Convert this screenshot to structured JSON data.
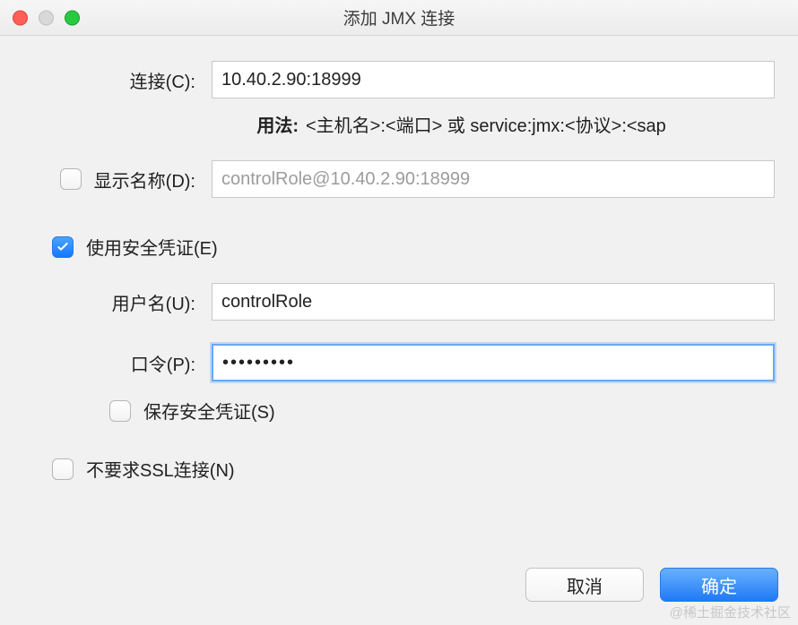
{
  "window": {
    "title": "添加 JMX 连接"
  },
  "form": {
    "connection_label": "连接(C):",
    "connection_value": "10.40.2.90:18999",
    "usage_label": "用法:",
    "usage_text": "<主机名>:<端口> 或 service:jmx:<协议>:<sap",
    "display_name_label": "显示名称(D):",
    "display_name_value": "controlRole@10.40.2.90:18999",
    "display_name_checked": false,
    "use_credentials_label": "使用安全凭证(E)",
    "use_credentials_checked": true,
    "username_label": "用户名(U):",
    "username_value": "controlRole",
    "password_label": "口令(P):",
    "password_value": "•••••••••",
    "save_credentials_label": "保存安全凭证(S)",
    "save_credentials_checked": false,
    "no_ssl_label": "不要求SSL连接(N)",
    "no_ssl_checked": false
  },
  "buttons": {
    "cancel": "取消",
    "ok": "确定"
  },
  "watermark": "@稀土掘金技术社区"
}
